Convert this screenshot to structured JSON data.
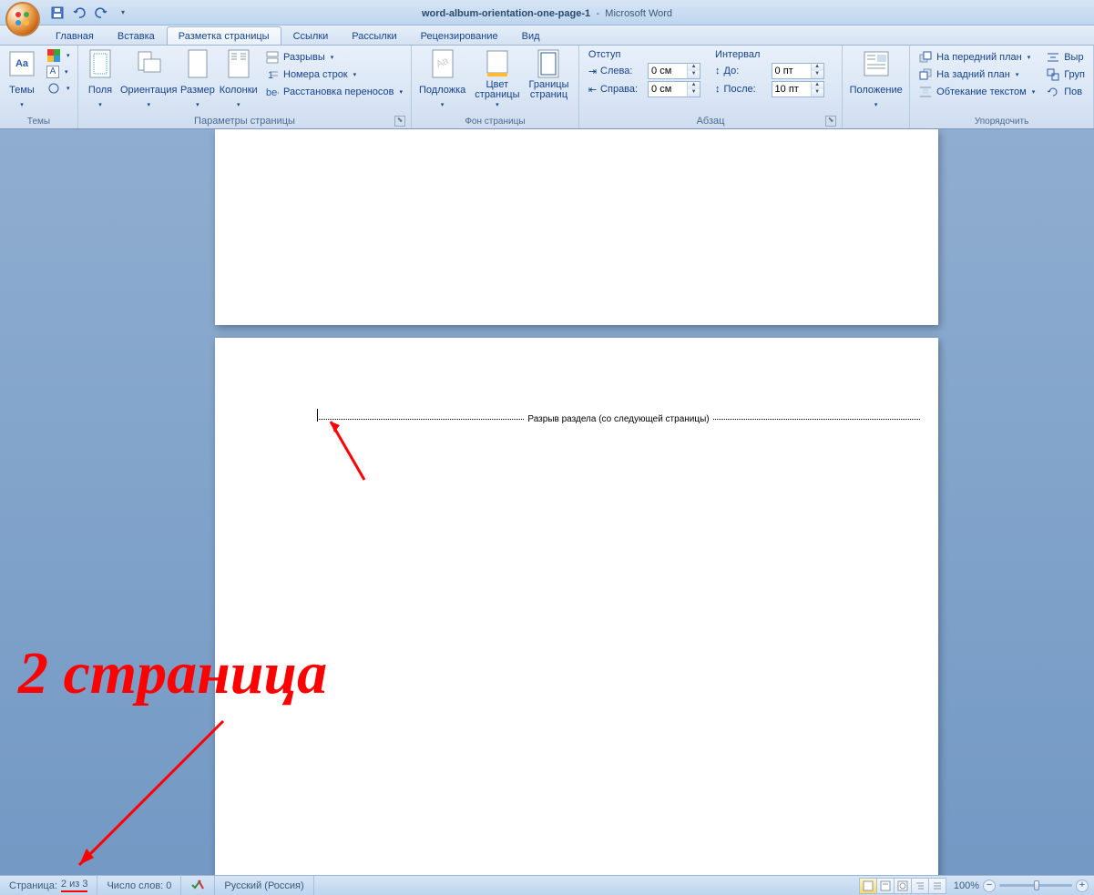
{
  "title": {
    "doc": "word-album-orientation-one-page-1",
    "app": "Microsoft Word"
  },
  "qat": {
    "save": "save-icon",
    "undo": "undo-icon",
    "redo": "redo-icon"
  },
  "tabs": [
    "Главная",
    "Вставка",
    "Разметка страницы",
    "Ссылки",
    "Рассылки",
    "Рецензирование",
    "Вид"
  ],
  "active_tab": 2,
  "ribbon": {
    "themes": {
      "label": "Темы",
      "themes_btn": "Темы"
    },
    "page_setup": {
      "label": "Параметры страницы",
      "margins": "Поля",
      "orientation": "Ориентация",
      "size": "Размер",
      "columns": "Колонки",
      "breaks": "Разрывы",
      "line_numbers": "Номера строк",
      "hyphenation": "Расстановка переносов"
    },
    "page_bg": {
      "label": "Фон страницы",
      "watermark": "Подложка",
      "color": "Цвет\nстраницы",
      "borders": "Границы\nстраниц"
    },
    "paragraph": {
      "label": "Абзац",
      "indent_title": "Отступ",
      "spacing_title": "Интервал",
      "left": "Слева:",
      "right": "Справа:",
      "before": "До:",
      "after": "После:",
      "left_val": "0 см",
      "right_val": "0 см",
      "before_val": "0 пт",
      "after_val": "10 пт"
    },
    "position": {
      "label": "",
      "btn": "Положение"
    },
    "arrange": {
      "label": "Упорядочить",
      "bring_front": "На передний план",
      "send_back": "На задний план",
      "text_wrap": "Обтекание текстом",
      "align": "Выр",
      "group": "Груп",
      "rotate": "Пов"
    }
  },
  "document": {
    "section_break_text": "Разрыв раздела (со следующей страницы)"
  },
  "annotation": {
    "big": "2 страница"
  },
  "status": {
    "page": "Страница: 2 из 3",
    "words": "Число слов: 0",
    "lang": "Русский (Россия)",
    "zoom": "100%"
  }
}
